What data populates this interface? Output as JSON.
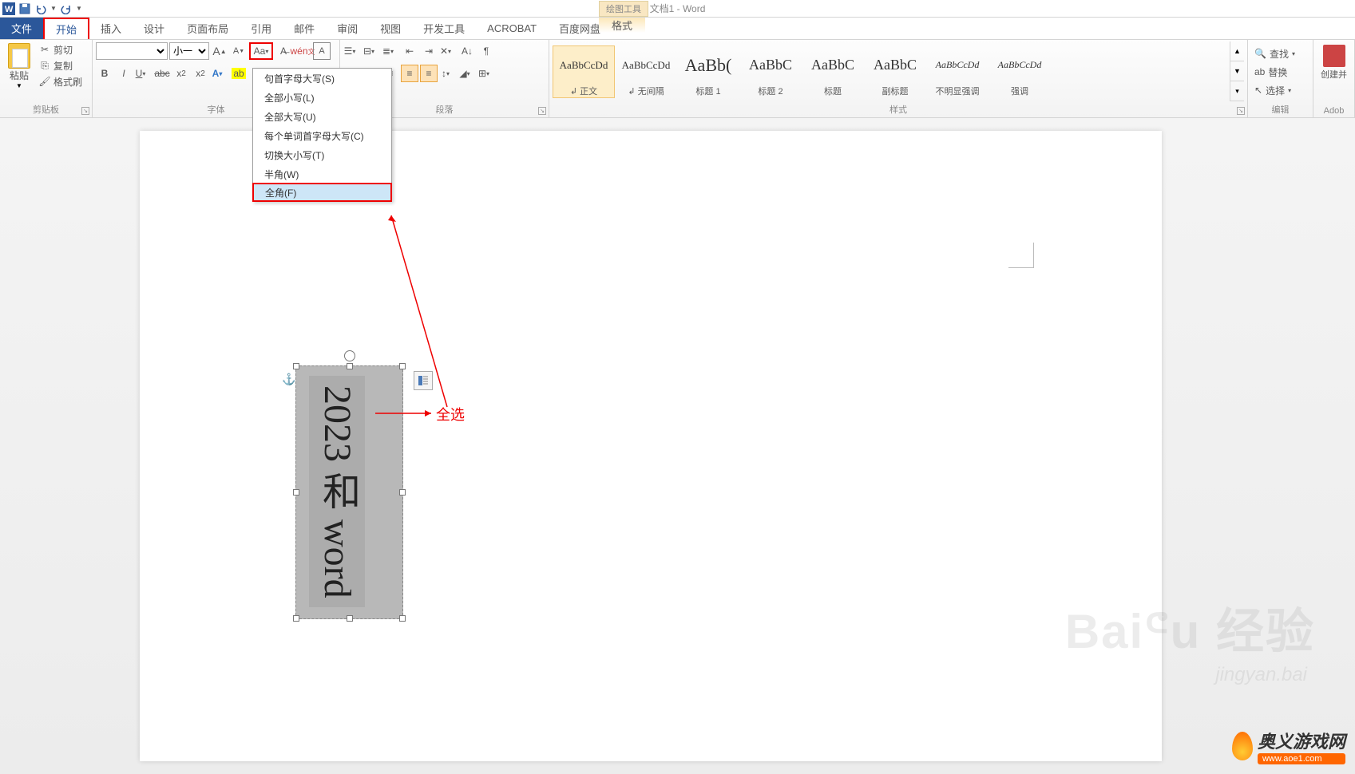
{
  "title": "文档1 - Word",
  "drawing_tools": "绘图工具",
  "tabs": {
    "file": "文件",
    "home": "开始",
    "insert": "插入",
    "design": "设计",
    "layout": "页面布局",
    "references": "引用",
    "mailings": "邮件",
    "review": "审阅",
    "view": "视图",
    "developer": "开发工具",
    "acrobat": "ACROBAT",
    "baidu": "百度网盘",
    "format": "格式"
  },
  "clipboard": {
    "paste": "粘贴",
    "cut": "剪切",
    "copy": "复制",
    "format_painter": "格式刷",
    "label": "剪贴板"
  },
  "font": {
    "size_value": "小一",
    "label": "字体"
  },
  "paragraph": {
    "label": "段落"
  },
  "styles": {
    "label": "样式",
    "items": [
      {
        "preview": "AaBbCcDd",
        "name": "↲ 正文",
        "size": "13px"
      },
      {
        "preview": "AaBbCcDd",
        "name": "↲ 无间隔",
        "size": "13px"
      },
      {
        "preview": "AaBb(",
        "name": "标题 1",
        "size": "22px"
      },
      {
        "preview": "AaBbC",
        "name": "标题 2",
        "size": "18px"
      },
      {
        "preview": "AaBbC",
        "name": "标题",
        "size": "18px"
      },
      {
        "preview": "AaBbC",
        "name": "副标题",
        "size": "18px"
      },
      {
        "preview": "AaBbCcDd",
        "name": "不明显强调",
        "size": "12px",
        "italic": true
      },
      {
        "preview": "AaBbCcDd",
        "name": "强调",
        "size": "12px",
        "italic": true
      }
    ]
  },
  "editing": {
    "find": "查找",
    "replace": "替换",
    "select": "选择",
    "label": "编辑"
  },
  "adobe": {
    "create": "创建并",
    "label": "Adob"
  },
  "change_case": {
    "sentence": "句首字母大写(S)",
    "lower": "全部小写(L)",
    "upper": "全部大写(U)",
    "cap_each": "每个单词首字母大写(C)",
    "toggle": "切换大小写(T)",
    "half": "半角(W)",
    "full": "全角(F)"
  },
  "textbox_content": "2023 和 word",
  "annotation": "全选",
  "watermark": {
    "main": "Baiᕪu 经验",
    "sub": "jingyan.bai"
  },
  "logo": {
    "text": "奥义游戏网",
    "url": "www.aoe1.com"
  }
}
